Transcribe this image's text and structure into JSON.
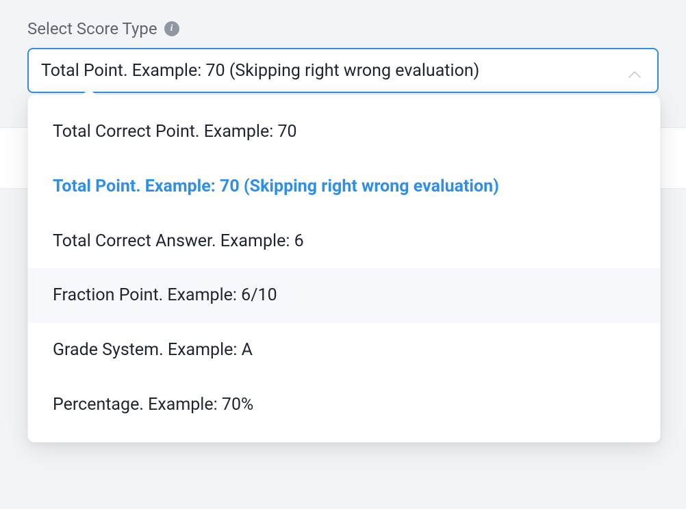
{
  "field": {
    "label": "Select Score Type",
    "selected_value": "Total Point. Example: 70 (Skipping right wrong evaluation)"
  },
  "dropdown": {
    "options": [
      {
        "label": "Total Correct Point. Example: 70"
      },
      {
        "label": "Total Point. Example: 70 (Skipping right wrong evaluation)"
      },
      {
        "label": "Total Correct Answer. Example: 6"
      },
      {
        "label": "Fraction Point. Example: 6/10"
      },
      {
        "label": "Grade System. Example: A"
      },
      {
        "label": "Percentage. Example: 70%"
      }
    ],
    "selected_index": 1,
    "hovered_index": 3
  }
}
